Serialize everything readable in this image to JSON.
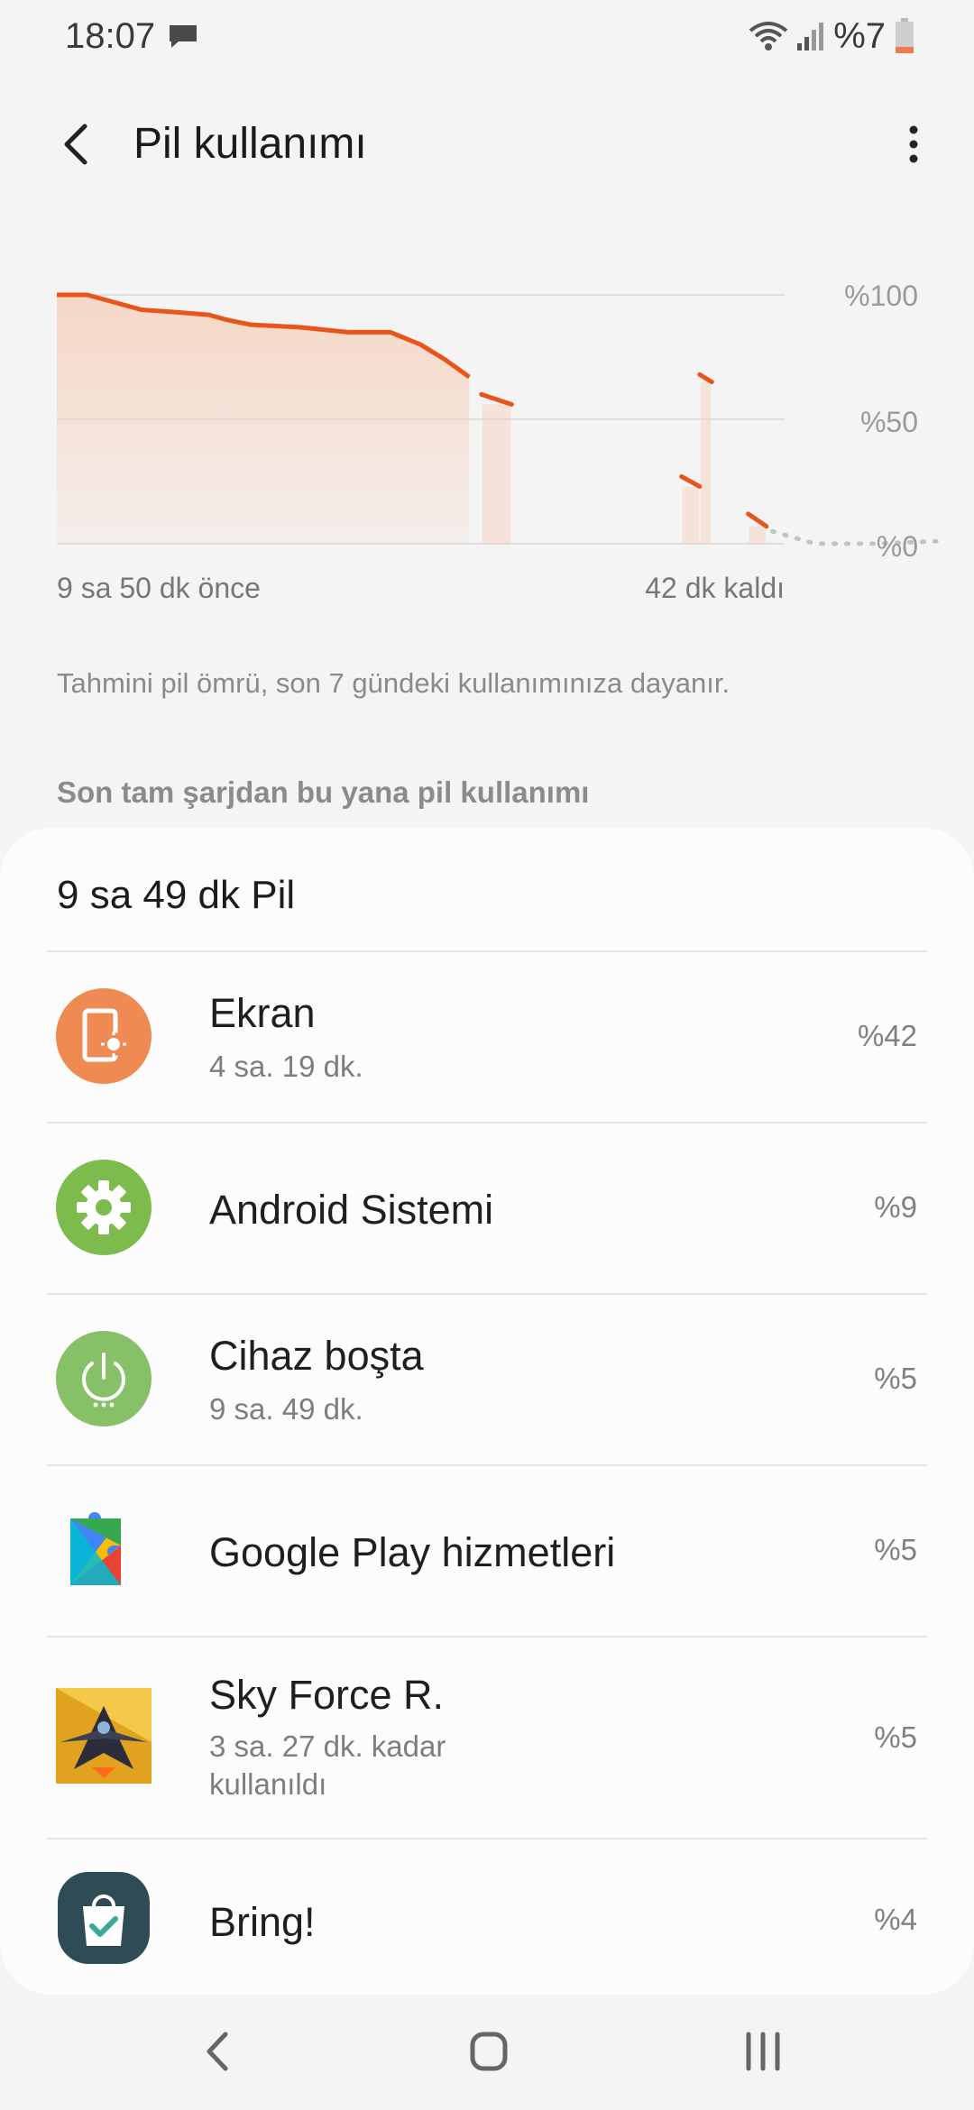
{
  "status_bar": {
    "time": "18:07",
    "battery_text": "%7"
  },
  "header": {
    "title": "Pil kullanımı"
  },
  "chart": {
    "y_ticks": [
      "%100",
      "%50",
      "%0"
    ],
    "x_start_label": "9 sa 50 dk önce",
    "x_end_label": "42 dk kaldı",
    "colors": {
      "line": "#e8541a",
      "fill": "#f6cdb6",
      "predicted": "#b9c6c2"
    }
  },
  "chart_data": {
    "type": "area",
    "ylim": [
      0,
      100
    ],
    "y_ticks": [
      "%100",
      "%50",
      "%0"
    ],
    "x_range_labels": [
      "9 sa 50 dk önce",
      "42 dk kaldı"
    ],
    "history": [
      [
        0,
        100
      ],
      [
        5,
        100
      ],
      [
        8,
        98
      ],
      [
        14,
        94
      ],
      [
        20,
        93
      ],
      [
        25,
        92
      ],
      [
        28,
        90
      ],
      [
        32,
        88
      ],
      [
        40,
        87
      ],
      [
        44,
        86
      ],
      [
        48,
        85
      ],
      [
        55,
        85
      ],
      [
        60,
        80
      ],
      [
        64,
        74
      ],
      [
        68,
        67
      ]
    ],
    "history_segments_after_gap": [
      [
        [
          70,
          60
        ],
        [
          75,
          56
        ]
      ],
      [
        [
          106,
          68
        ],
        [
          108,
          65
        ]
      ],
      [
        [
          103,
          27
        ],
        [
          106,
          23
        ]
      ],
      [
        [
          114,
          12
        ],
        [
          117,
          7
        ]
      ]
    ],
    "predicted": [
      [
        118,
        5
      ],
      [
        125,
        0
      ],
      [
        135,
        0
      ],
      [
        145,
        1
      ]
    ],
    "grid": true
  },
  "note": "Tahmini pil ömrü, son 7 gündeki kullanımınıza dayanır.",
  "section_title": "Son tam şarjdan bu yana pil kullanımı",
  "card": {
    "heading": "9 sa 49 dk Pil",
    "items": [
      {
        "name": "Ekran",
        "sub": "4 sa. 19 dk.",
        "pct": "%42",
        "icon": "screen-brightness-icon",
        "color": "#ef8a52"
      },
      {
        "name": "Android Sistemi",
        "sub": "",
        "pct": "%9",
        "icon": "gear-icon",
        "color": "#7dbb4c"
      },
      {
        "name": "Cihaz boşta",
        "sub": "9 sa. 49 dk.",
        "pct": "%5",
        "icon": "power-icon",
        "color": "#86c067"
      },
      {
        "name": "Google Play hizmetleri",
        "sub": "",
        "pct": "%5",
        "icon": "google-play-services-icon",
        "color": "#4caf50"
      },
      {
        "name": "Sky Force R.",
        "sub": "3 sa. 27 dk. kadar\nkullanıldı",
        "pct": "%5",
        "icon": "sky-force-app-icon",
        "color": "#d99a20"
      },
      {
        "name": "Bring!",
        "sub": "",
        "pct": "%4",
        "icon": "bring-app-icon",
        "color": "#2f4b55"
      }
    ]
  }
}
